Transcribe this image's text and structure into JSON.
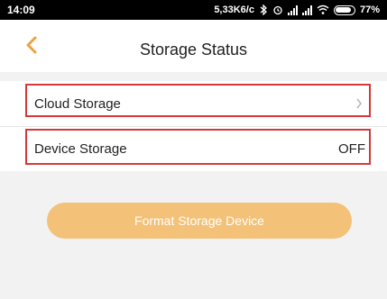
{
  "status_bar": {
    "time": "14:09",
    "network_speed": "5,33K6/c",
    "battery_percent": "77%",
    "icons": [
      "bluetooth-icon",
      "alarm-icon",
      "signal-icon",
      "signal-icon",
      "wifi-icon",
      "battery-icon"
    ]
  },
  "header": {
    "title": "Storage Status",
    "back_icon": "chevron-left-icon"
  },
  "rows": {
    "cloud": {
      "label": "Cloud Storage",
      "chevron": "›"
    },
    "device": {
      "label": "Device Storage",
      "value": "OFF"
    }
  },
  "actions": {
    "format_label": "Format Storage Device"
  },
  "colors": {
    "accent": "#f0a040",
    "button_bg": "#f3c178",
    "highlight": "#d23a3a"
  }
}
